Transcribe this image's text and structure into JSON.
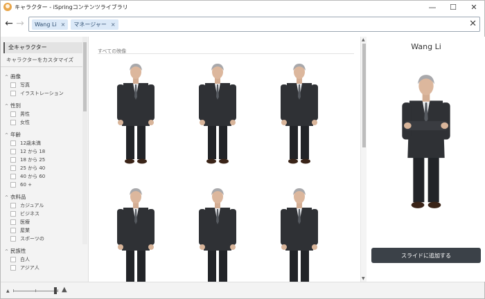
{
  "window": {
    "title": "キャラクター - iSpringコンテンツライブラリ",
    "buttons": {
      "minimize": "—",
      "maximize": "☐",
      "close": "✕"
    }
  },
  "nav": {
    "back_icon": "arrow-left-icon",
    "forward_icon": "arrow-right-icon",
    "chips": [
      {
        "label": "Wang Li"
      },
      {
        "label": "マネージャー"
      }
    ],
    "chip_remove": "×",
    "clear": "✕"
  },
  "sidebar": {
    "all_characters": "全キャラクター",
    "customize": "キャラクターをカスタマイズ",
    "sections": [
      {
        "title": "画像",
        "options": [
          "写真",
          "イラストレーション"
        ]
      },
      {
        "title": "性別",
        "options": [
          "男性",
          "女性"
        ]
      },
      {
        "title": "年齢",
        "options": [
          "12歳未満",
          "12 から 18",
          "18 から 25",
          "25 から 40",
          "40 から 60",
          "60 +"
        ]
      },
      {
        "title": "衣料品",
        "options": [
          "カジュアル",
          "ビジネス",
          "医療",
          "屋業",
          "スポーツの"
        ]
      },
      {
        "title": "民族性",
        "options": [
          "白人",
          "アジア人"
        ]
      }
    ]
  },
  "main": {
    "section_title": "すべての映像",
    "images": [
      {
        "pose": "arms-down"
      },
      {
        "pose": "arms-down"
      },
      {
        "pose": "arms-down"
      },
      {
        "pose": "arms-down"
      },
      {
        "pose": "arms-down"
      },
      {
        "pose": "arms-down"
      }
    ]
  },
  "detail": {
    "name": "Wang Li",
    "add_button": "スライドに追加する"
  },
  "footer": {
    "zoom_small_icon": "mountain-small-icon",
    "zoom_large_icon": "mountain-large-icon",
    "zoom_level": 0.95
  },
  "colors": {
    "chip_bg": "#dbe9f8",
    "button_dark": "#3b4148",
    "suit": "#2f3135",
    "shirt": "#f2f4f6"
  }
}
